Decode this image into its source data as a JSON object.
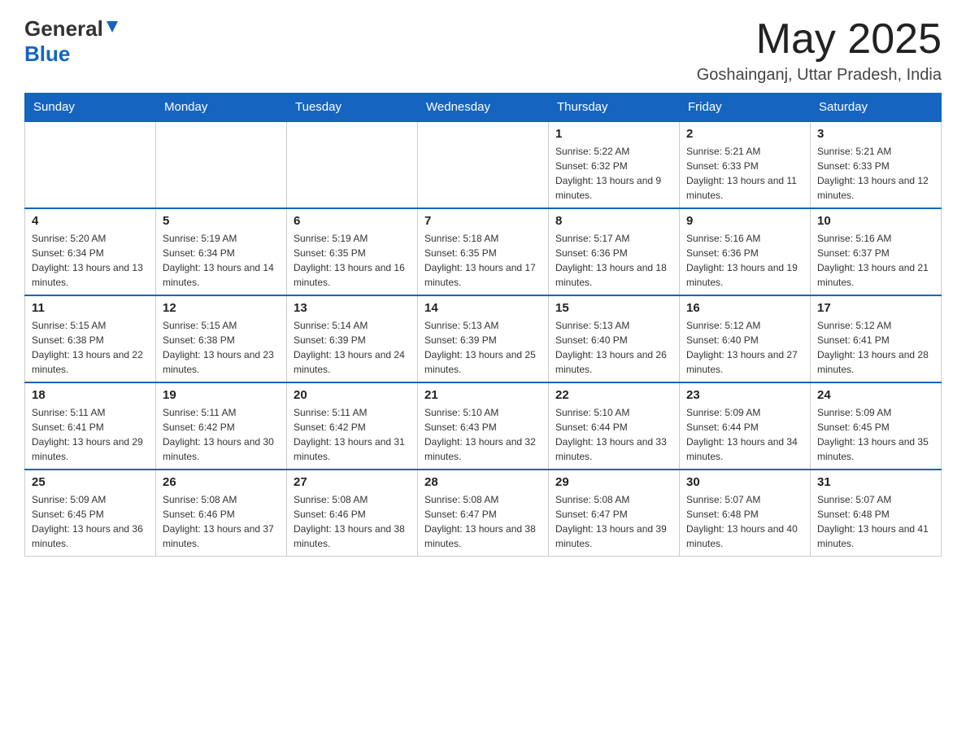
{
  "logo": {
    "general": "General",
    "blue": "Blue",
    "arrow": "▼"
  },
  "title": "May 2025",
  "location": "Goshainganj, Uttar Pradesh, India",
  "days_of_week": [
    "Sunday",
    "Monday",
    "Tuesday",
    "Wednesday",
    "Thursday",
    "Friday",
    "Saturday"
  ],
  "weeks": [
    [
      {
        "day": "",
        "info": ""
      },
      {
        "day": "",
        "info": ""
      },
      {
        "day": "",
        "info": ""
      },
      {
        "day": "",
        "info": ""
      },
      {
        "day": "1",
        "info": "Sunrise: 5:22 AM\nSunset: 6:32 PM\nDaylight: 13 hours and 9 minutes."
      },
      {
        "day": "2",
        "info": "Sunrise: 5:21 AM\nSunset: 6:33 PM\nDaylight: 13 hours and 11 minutes."
      },
      {
        "day": "3",
        "info": "Sunrise: 5:21 AM\nSunset: 6:33 PM\nDaylight: 13 hours and 12 minutes."
      }
    ],
    [
      {
        "day": "4",
        "info": "Sunrise: 5:20 AM\nSunset: 6:34 PM\nDaylight: 13 hours and 13 minutes."
      },
      {
        "day": "5",
        "info": "Sunrise: 5:19 AM\nSunset: 6:34 PM\nDaylight: 13 hours and 14 minutes."
      },
      {
        "day": "6",
        "info": "Sunrise: 5:19 AM\nSunset: 6:35 PM\nDaylight: 13 hours and 16 minutes."
      },
      {
        "day": "7",
        "info": "Sunrise: 5:18 AM\nSunset: 6:35 PM\nDaylight: 13 hours and 17 minutes."
      },
      {
        "day": "8",
        "info": "Sunrise: 5:17 AM\nSunset: 6:36 PM\nDaylight: 13 hours and 18 minutes."
      },
      {
        "day": "9",
        "info": "Sunrise: 5:16 AM\nSunset: 6:36 PM\nDaylight: 13 hours and 19 minutes."
      },
      {
        "day": "10",
        "info": "Sunrise: 5:16 AM\nSunset: 6:37 PM\nDaylight: 13 hours and 21 minutes."
      }
    ],
    [
      {
        "day": "11",
        "info": "Sunrise: 5:15 AM\nSunset: 6:38 PM\nDaylight: 13 hours and 22 minutes."
      },
      {
        "day": "12",
        "info": "Sunrise: 5:15 AM\nSunset: 6:38 PM\nDaylight: 13 hours and 23 minutes."
      },
      {
        "day": "13",
        "info": "Sunrise: 5:14 AM\nSunset: 6:39 PM\nDaylight: 13 hours and 24 minutes."
      },
      {
        "day": "14",
        "info": "Sunrise: 5:13 AM\nSunset: 6:39 PM\nDaylight: 13 hours and 25 minutes."
      },
      {
        "day": "15",
        "info": "Sunrise: 5:13 AM\nSunset: 6:40 PM\nDaylight: 13 hours and 26 minutes."
      },
      {
        "day": "16",
        "info": "Sunrise: 5:12 AM\nSunset: 6:40 PM\nDaylight: 13 hours and 27 minutes."
      },
      {
        "day": "17",
        "info": "Sunrise: 5:12 AM\nSunset: 6:41 PM\nDaylight: 13 hours and 28 minutes."
      }
    ],
    [
      {
        "day": "18",
        "info": "Sunrise: 5:11 AM\nSunset: 6:41 PM\nDaylight: 13 hours and 29 minutes."
      },
      {
        "day": "19",
        "info": "Sunrise: 5:11 AM\nSunset: 6:42 PM\nDaylight: 13 hours and 30 minutes."
      },
      {
        "day": "20",
        "info": "Sunrise: 5:11 AM\nSunset: 6:42 PM\nDaylight: 13 hours and 31 minutes."
      },
      {
        "day": "21",
        "info": "Sunrise: 5:10 AM\nSunset: 6:43 PM\nDaylight: 13 hours and 32 minutes."
      },
      {
        "day": "22",
        "info": "Sunrise: 5:10 AM\nSunset: 6:44 PM\nDaylight: 13 hours and 33 minutes."
      },
      {
        "day": "23",
        "info": "Sunrise: 5:09 AM\nSunset: 6:44 PM\nDaylight: 13 hours and 34 minutes."
      },
      {
        "day": "24",
        "info": "Sunrise: 5:09 AM\nSunset: 6:45 PM\nDaylight: 13 hours and 35 minutes."
      }
    ],
    [
      {
        "day": "25",
        "info": "Sunrise: 5:09 AM\nSunset: 6:45 PM\nDaylight: 13 hours and 36 minutes."
      },
      {
        "day": "26",
        "info": "Sunrise: 5:08 AM\nSunset: 6:46 PM\nDaylight: 13 hours and 37 minutes."
      },
      {
        "day": "27",
        "info": "Sunrise: 5:08 AM\nSunset: 6:46 PM\nDaylight: 13 hours and 38 minutes."
      },
      {
        "day": "28",
        "info": "Sunrise: 5:08 AM\nSunset: 6:47 PM\nDaylight: 13 hours and 38 minutes."
      },
      {
        "day": "29",
        "info": "Sunrise: 5:08 AM\nSunset: 6:47 PM\nDaylight: 13 hours and 39 minutes."
      },
      {
        "day": "30",
        "info": "Sunrise: 5:07 AM\nSunset: 6:48 PM\nDaylight: 13 hours and 40 minutes."
      },
      {
        "day": "31",
        "info": "Sunrise: 5:07 AM\nSunset: 6:48 PM\nDaylight: 13 hours and 41 minutes."
      }
    ]
  ],
  "colors": {
    "header_bg": "#1565c0",
    "header_text": "#ffffff",
    "border": "#1565c0",
    "logo_blue": "#1565c0"
  }
}
